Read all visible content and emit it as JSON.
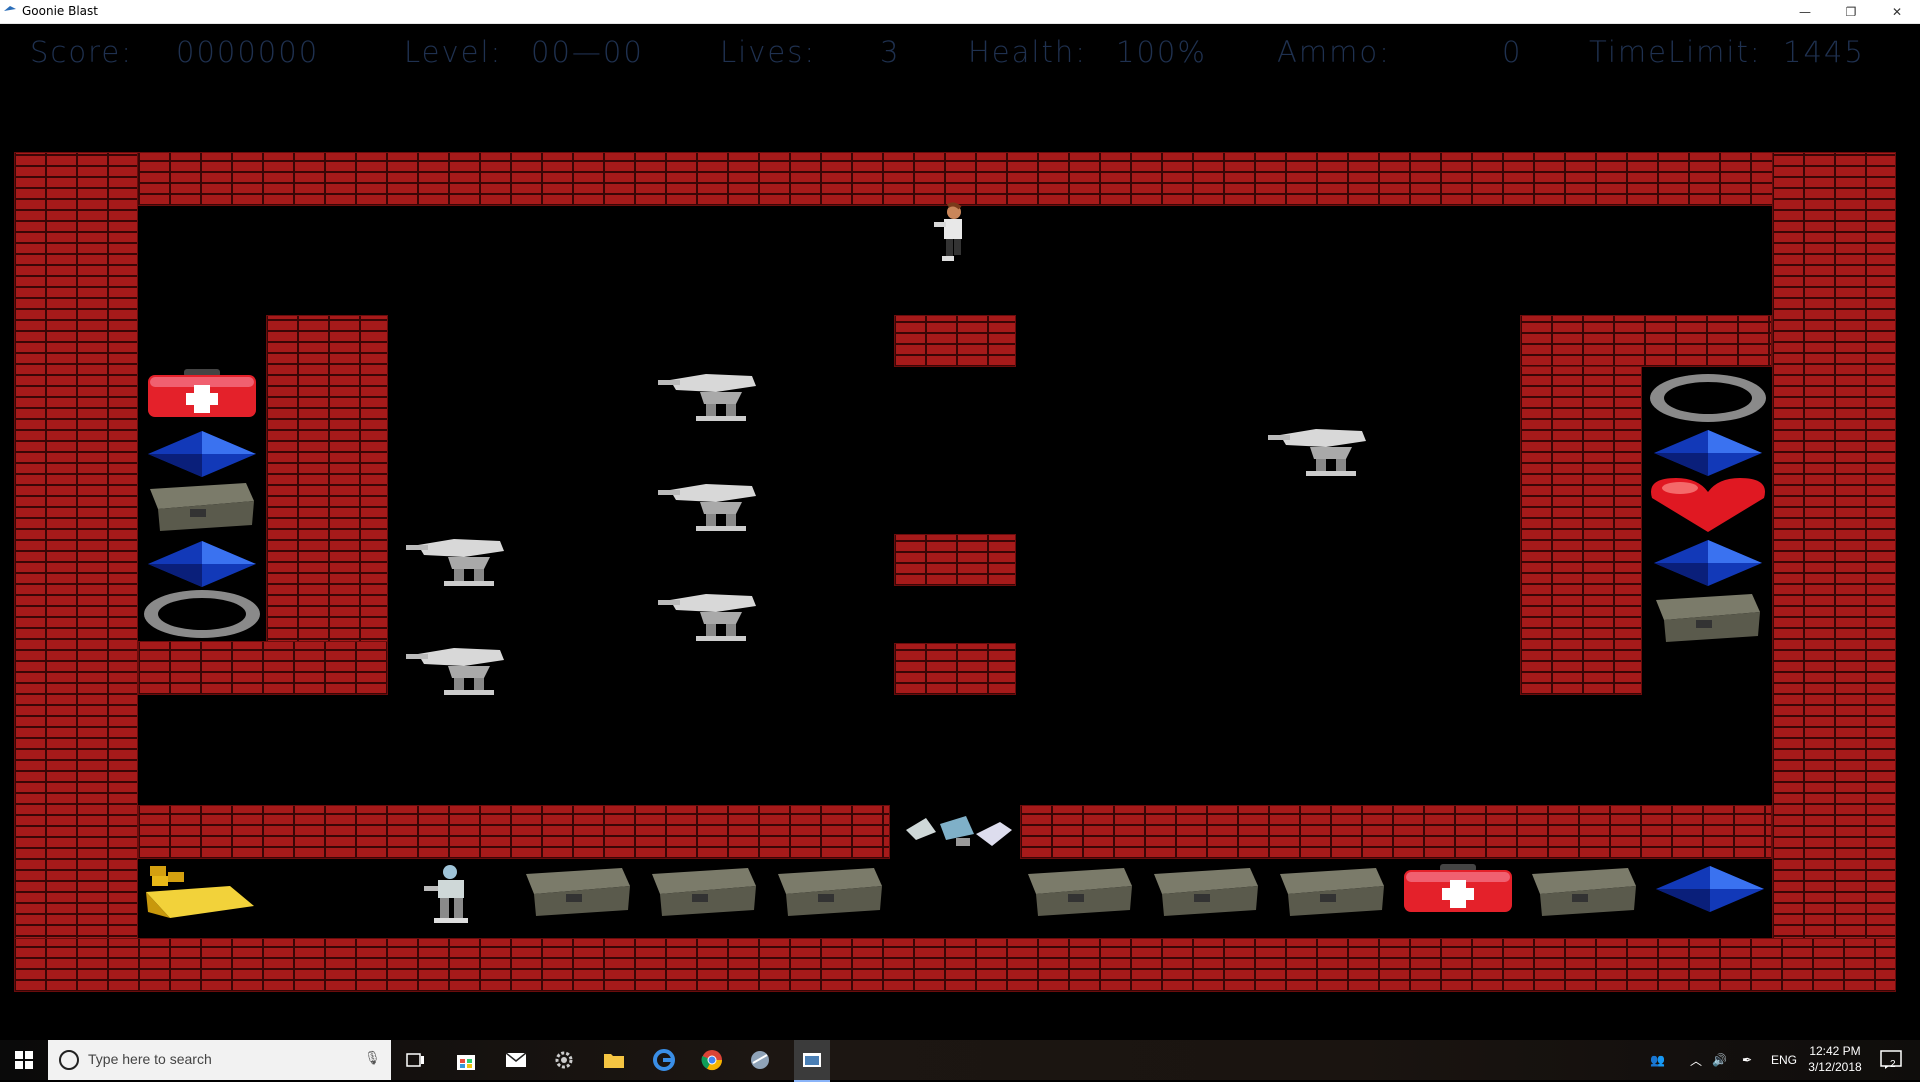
{
  "window": {
    "title": "Goonie Blast",
    "minimize": "—",
    "maximize": "❐",
    "close": "✕"
  },
  "hud": {
    "score_label": "Score:",
    "score": "0000000",
    "level_label": "Level:",
    "level": "00—00",
    "lives_label": "Lives:",
    "lives": "3",
    "health_label": "Health:",
    "health": "100%",
    "ammo_label": "Ammo:",
    "ammo": "0",
    "time_label": "TimeLimit:",
    "time": "1445"
  },
  "colors": {
    "brick": "#a61a1a",
    "mortar": "#3a0606",
    "hud_text": "#1f3150",
    "background": "#000000"
  },
  "sprites": {
    "player": "player-icon",
    "robot": "robot-enemy-icon",
    "medkit": "medkit-icon",
    "gem": "blue-gem-icon",
    "ammo": "ammo-crate-icon",
    "portal": "black-hole-portal-icon",
    "heart": "heart-icon",
    "gold": "gold-treasure-icon",
    "debris": "broken-robot-icon"
  },
  "taskbar": {
    "search_placeholder": "Type here to search",
    "language": "ENG",
    "time": "12:42 PM",
    "date": "3/12/2018",
    "notifications": "2"
  }
}
